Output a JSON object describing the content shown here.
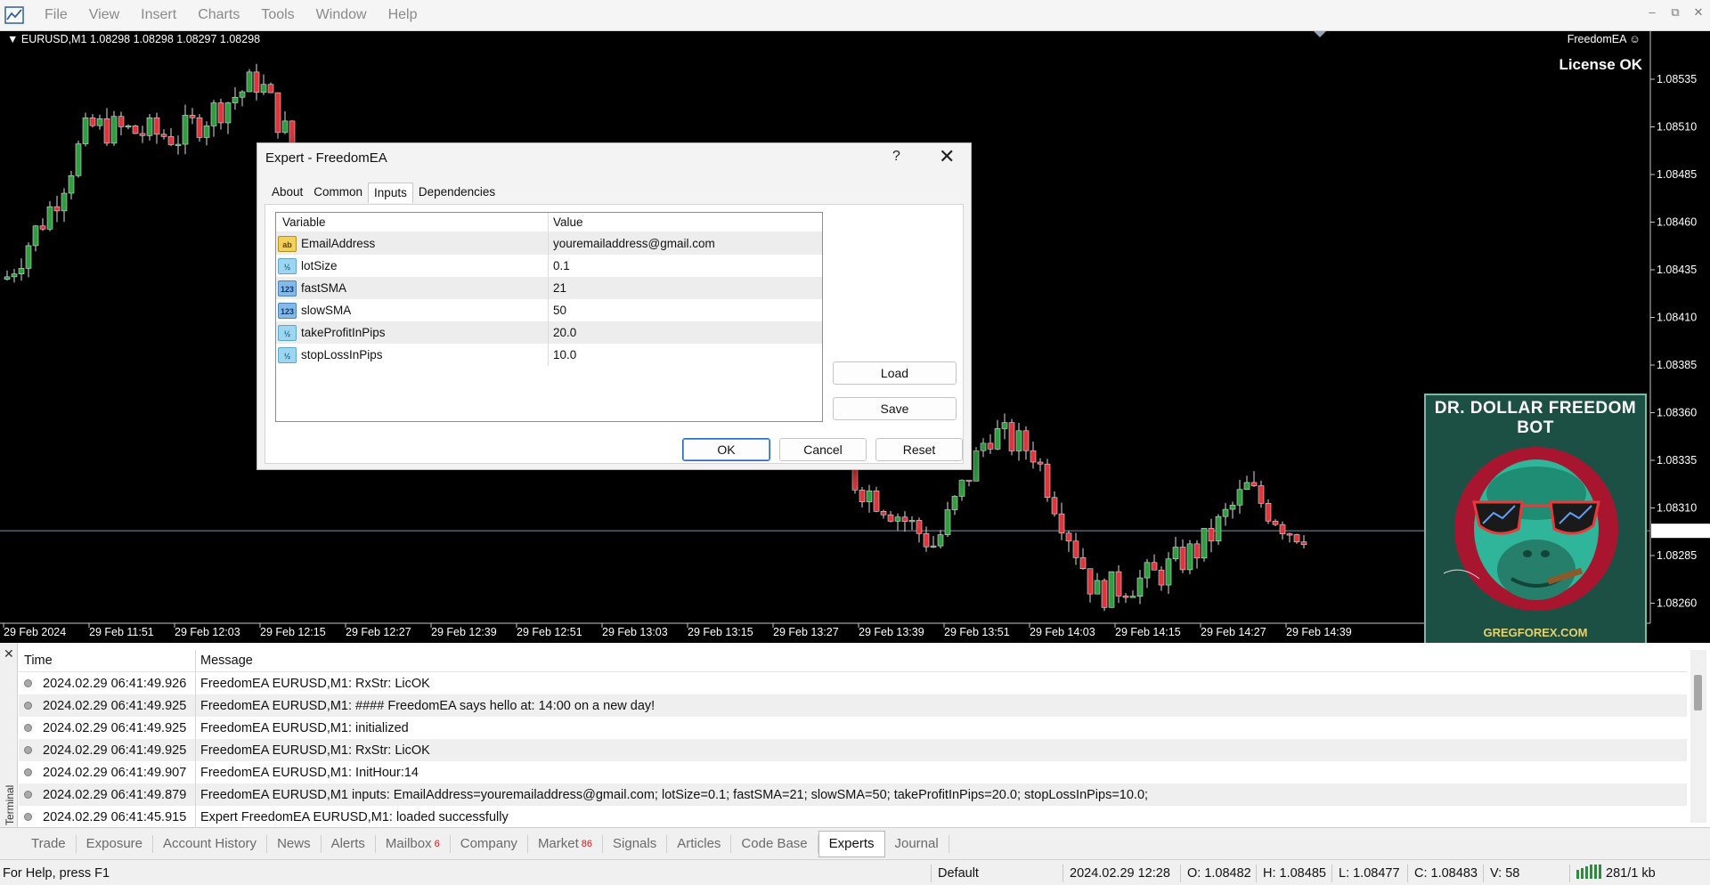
{
  "menu": [
    "File",
    "View",
    "Insert",
    "Charts",
    "Tools",
    "Window",
    "Help"
  ],
  "chart": {
    "symbol_header": "EURUSD,M1  1.08298 1.08298 1.08297 1.08298",
    "ea_name": "FreedomEA ☺",
    "license": "License OK",
    "current_price": "1.08298",
    "price_ticks": [
      "1.08535",
      "1.08510",
      "1.08485",
      "1.08460",
      "1.08435",
      "1.08410",
      "1.08385",
      "1.08360",
      "1.08335",
      "1.08310",
      "1.08285",
      "1.08260"
    ],
    "time_ticks": [
      "29 Feb 2024",
      "29 Feb 11:51",
      "29 Feb 12:03",
      "29 Feb 12:15",
      "29 Feb 12:27",
      "29 Feb 12:39",
      "29 Feb 12:51",
      "29 Feb 13:03",
      "29 Feb 13:15",
      "29 Feb 13:27",
      "29 Feb 13:39",
      "29 Feb 13:51",
      "29 Feb 14:03",
      "29 Feb 14:15",
      "29 Feb 14:27",
      "29 Feb 14:39"
    ],
    "bull_color": "#2e9e3e",
    "bear_color": "#e0353b"
  },
  "bot": {
    "title": "DR. DOLLAR FREEDOM BOT",
    "site": "GREGFOREX.COM"
  },
  "dialog": {
    "title": "Expert - FreedomEA",
    "help": "?",
    "close": "✕",
    "tabs": [
      "About",
      "Common",
      "Inputs",
      "Dependencies"
    ],
    "active_tab": "Inputs",
    "headers": {
      "variable": "Variable",
      "value": "Value"
    },
    "inputs": [
      {
        "icon": "ab",
        "kind": "str",
        "name": "EmailAddress",
        "value": "youremailaddress@gmail.com"
      },
      {
        "icon": "½",
        "kind": "dbl",
        "name": "lotSize",
        "value": "0.1"
      },
      {
        "icon": "123",
        "kind": "int",
        "name": "fastSMA",
        "value": "21"
      },
      {
        "icon": "123",
        "kind": "int",
        "name": "slowSMA",
        "value": "50"
      },
      {
        "icon": "½",
        "kind": "dbl",
        "name": "takeProfitInPips",
        "value": "20.0"
      },
      {
        "icon": "½",
        "kind": "dbl",
        "name": "stopLossInPips",
        "value": "10.0"
      }
    ],
    "buttons": {
      "load": "Load",
      "save": "Save",
      "ok": "OK",
      "cancel": "Cancel",
      "reset": "Reset"
    }
  },
  "terminal": {
    "side_label": "Terminal",
    "headers": {
      "time": "Time",
      "message": "Message"
    },
    "log": [
      {
        "time": "2024.02.29 06:41:49.926",
        "message": "FreedomEA EURUSD,M1: RxStr: LicOK"
      },
      {
        "time": "2024.02.29 06:41:49.925",
        "message": "FreedomEA EURUSD,M1: #### FreedomEA says hello at: 14:00 on a new day!"
      },
      {
        "time": "2024.02.29 06:41:49.925",
        "message": "FreedomEA EURUSD,M1: initialized"
      },
      {
        "time": "2024.02.29 06:41:49.925",
        "message": "FreedomEA EURUSD,M1: RxStr: LicOK"
      },
      {
        "time": "2024.02.29 06:41:49.907",
        "message": "FreedomEA EURUSD,M1: InitHour:14"
      },
      {
        "time": "2024.02.29 06:41:49.879",
        "message": "FreedomEA EURUSD,M1 inputs: EmailAddress=youremailaddress@gmail.com; lotSize=0.1; fastSMA=21; slowSMA=50; takeProfitInPips=20.0; stopLossInPips=10.0;"
      },
      {
        "time": "2024.02.29 06:41:45.915",
        "message": "Expert FreedomEA EURUSD,M1: loaded successfully"
      }
    ]
  },
  "bottom_tabs": [
    {
      "label": "Trade",
      "badge": ""
    },
    {
      "label": "Exposure",
      "badge": ""
    },
    {
      "label": "Account History",
      "badge": ""
    },
    {
      "label": "News",
      "badge": ""
    },
    {
      "label": "Alerts",
      "badge": ""
    },
    {
      "label": "Mailbox",
      "badge": "6"
    },
    {
      "label": "Company",
      "badge": ""
    },
    {
      "label": "Market",
      "badge": "86"
    },
    {
      "label": "Signals",
      "badge": ""
    },
    {
      "label": "Articles",
      "badge": ""
    },
    {
      "label": "Code Base",
      "badge": ""
    },
    {
      "label": "Experts",
      "badge": ""
    },
    {
      "label": "Journal",
      "badge": ""
    }
  ],
  "active_bottom_tab": "Experts",
  "status": {
    "help": "For Help, press F1",
    "profile": "Default",
    "datetime": "2024.02.29 12:28",
    "open": "O: 1.08482",
    "high": "H: 1.08485",
    "low": "L: 1.08477",
    "close": "C: 1.08483",
    "volume": "V: 58",
    "traffic": "281/1 kb"
  }
}
